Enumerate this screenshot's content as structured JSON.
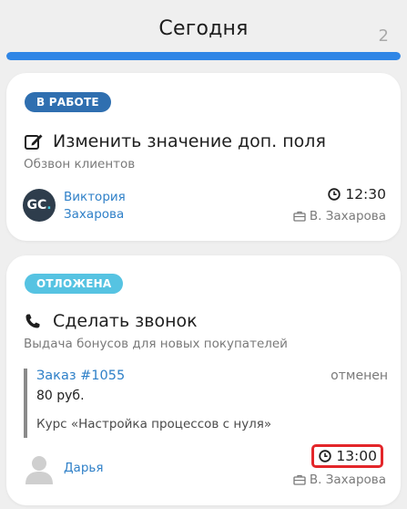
{
  "column": {
    "title": "Сегодня",
    "count": "2",
    "progress": 1.0,
    "progress_color": "#2f86e6"
  },
  "cards": [
    {
      "status": "В РАБОТЕ",
      "status_color": "#2f6fb0",
      "task_icon": "edit-icon",
      "title": "Изменить значение доп. поля",
      "subtitle": "Обзвон клиентов",
      "avatar_initials": "GC",
      "avatar_initials_accent": ".",
      "person_line1": "Виктория",
      "person_line2": "Захарова",
      "time": "12:30",
      "assignee": "В. Захарова"
    },
    {
      "status": "ОТЛОЖЕНА",
      "status_color": "#56c3e2",
      "task_icon": "phone-icon",
      "title": "Сделать звонок",
      "subtitle": "Выдача бонусов для новых покупателей",
      "deal": {
        "link": "Заказ #1055",
        "status": "отменен",
        "amount": "80 руб.",
        "course": "Курс «Настройка процессов с нуля»"
      },
      "avatar_icon": "user-placeholder-icon",
      "person_name": "Дарья",
      "time": "13:00",
      "time_highlight_color": "#e3262a",
      "assignee": "В. Захарова"
    }
  ]
}
